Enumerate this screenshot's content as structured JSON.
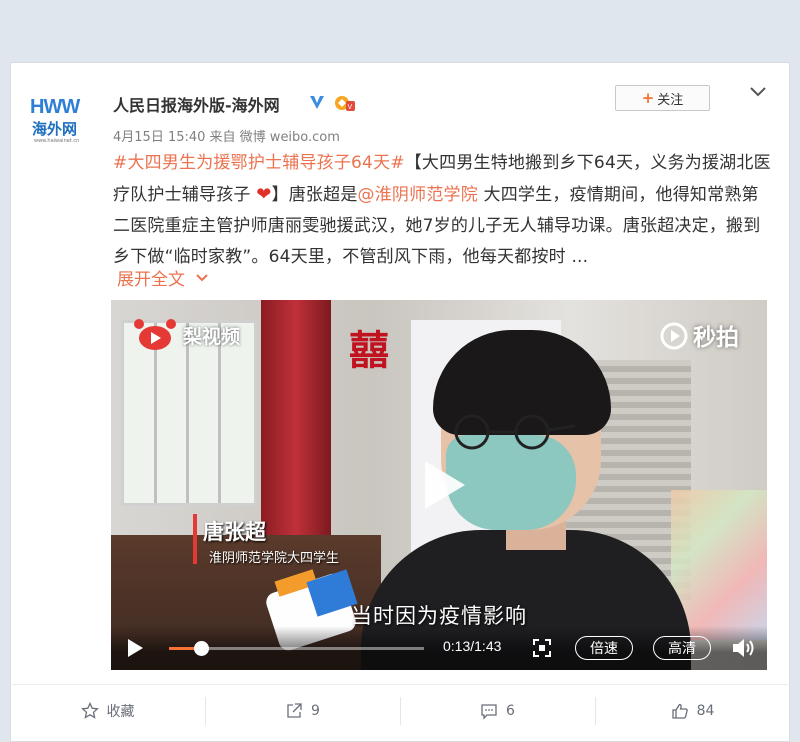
{
  "post": {
    "author": "人民日报海外版-海外网",
    "avatar": {
      "logo_top": "HWW",
      "logo_cn": "海外网",
      "logo_small": "www.haiwainet.cn"
    },
    "meta": "4月15日 15:40 来自 微博 weibo.com",
    "follow_label": "关注",
    "topic": "#大四男生为援鄂护士辅导孩子64天#",
    "text_part1": "【大四男生特地搬到乡下64天，义务为援湖北医疗队护士辅导孩子 ",
    "text_part2": "】唐张超是",
    "mention": "@淮阴师范学院",
    "text_part3": " 大四学生，疫情期间，他得知常熟第二医院重症主管护师唐丽雯驰援武汉，她7岁的儿子无人辅导功课。唐张超决定，搬到乡下做“临时家教”。64天里，不管刮风下雨，他每天都按时 ...",
    "expand_label": "展开全文"
  },
  "video": {
    "channel_logo": "梨视频",
    "watermark": "秒拍",
    "caption_name": "唐张超",
    "caption_sub": "淮阴师范学院大四学生",
    "subtitle": "当时因为疫情影响",
    "time": "0:13/1:43",
    "progress_fraction": 0.126,
    "speed_label": "倍速",
    "hd_label": "高清"
  },
  "footer": {
    "favorite_label": "收藏",
    "repost_count": "9",
    "comment_count": "6",
    "like_count": "84"
  },
  "colors": {
    "link": "#eb7350",
    "accent": "#f77234"
  }
}
